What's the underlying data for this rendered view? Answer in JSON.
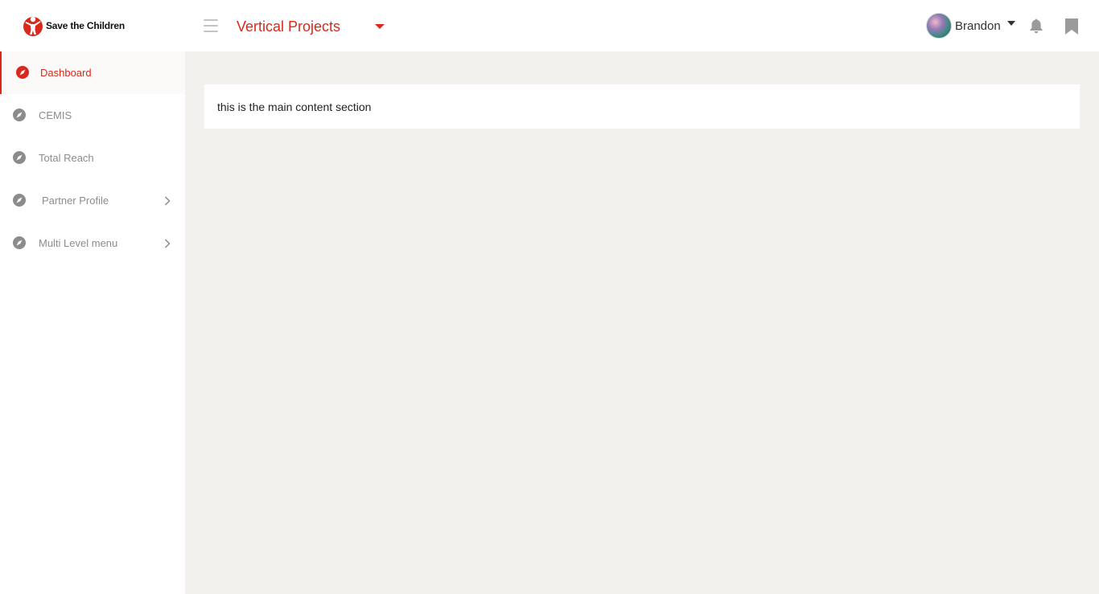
{
  "brand": {
    "name": "Save the Children",
    "accent": "#da291c"
  },
  "header": {
    "menu_icon": "hamburger-icon",
    "project": {
      "selected": "Vertical Projects",
      "caret_icon": "caret-down-icon"
    },
    "user": {
      "name": "Brandon",
      "caret_icon": "caret-down-icon"
    },
    "notification_icon": "bell-icon",
    "bookmark_icon": "bookmark-icon"
  },
  "sidebar": {
    "items": [
      {
        "label": "Dashboard",
        "icon": "compass-icon",
        "active": true,
        "has_children": false
      },
      {
        "label": "CEMIS",
        "icon": "compass-icon",
        "active": false,
        "has_children": false
      },
      {
        "label": "Total Reach",
        "icon": "compass-icon",
        "active": false,
        "has_children": false
      },
      {
        "label": "Partner Profile",
        "icon": "compass-icon",
        "active": false,
        "has_children": true
      },
      {
        "label": "Multi Level menu",
        "icon": "compass-icon",
        "active": false,
        "has_children": true
      }
    ]
  },
  "main": {
    "content_text": "this is the main content section"
  },
  "colors": {
    "background": "#f2f1ee",
    "sidebar": "#ffffff",
    "muted_text": "#8c8c8c",
    "accent": "#da291c"
  }
}
